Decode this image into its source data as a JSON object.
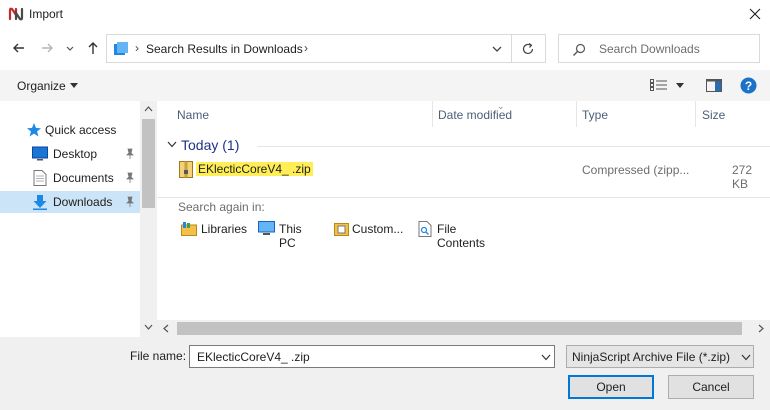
{
  "window": {
    "title": "Import"
  },
  "address": {
    "location": "Search Results in Downloads"
  },
  "search": {
    "placeholder": "Search Downloads"
  },
  "toolbar": {
    "organize_label": "Organize"
  },
  "sidebar": {
    "items": [
      {
        "label": "Quick access"
      },
      {
        "label": "Desktop"
      },
      {
        "label": "Documents"
      },
      {
        "label": "Downloads"
      }
    ]
  },
  "columns": {
    "name": "Name",
    "date_modified": "Date modified",
    "type": "Type",
    "size": "Size"
  },
  "group": {
    "label": "Today (1)"
  },
  "files": [
    {
      "name": "EKlecticCoreV4_        .zip",
      "date_modified": "",
      "type": "Compressed (zipp...",
      "size": "272 KB"
    }
  ],
  "search_again": {
    "label": "Search again in:",
    "locations": [
      {
        "label": "Libraries"
      },
      {
        "label": "This PC"
      },
      {
        "label": "Custom..."
      },
      {
        "label": "File Contents"
      }
    ]
  },
  "footer": {
    "file_name_label": "File name:",
    "file_name_value": "EKlecticCoreV4_    .zip",
    "file_type_value": "NinjaScript Archive File (*.zip)",
    "open_label": "Open",
    "cancel_label": "Cancel"
  },
  "colors": {
    "accent": "#0078d7",
    "selection": "#cce4f7",
    "highlight": "#ffee55",
    "group_header": "#1e3287"
  }
}
